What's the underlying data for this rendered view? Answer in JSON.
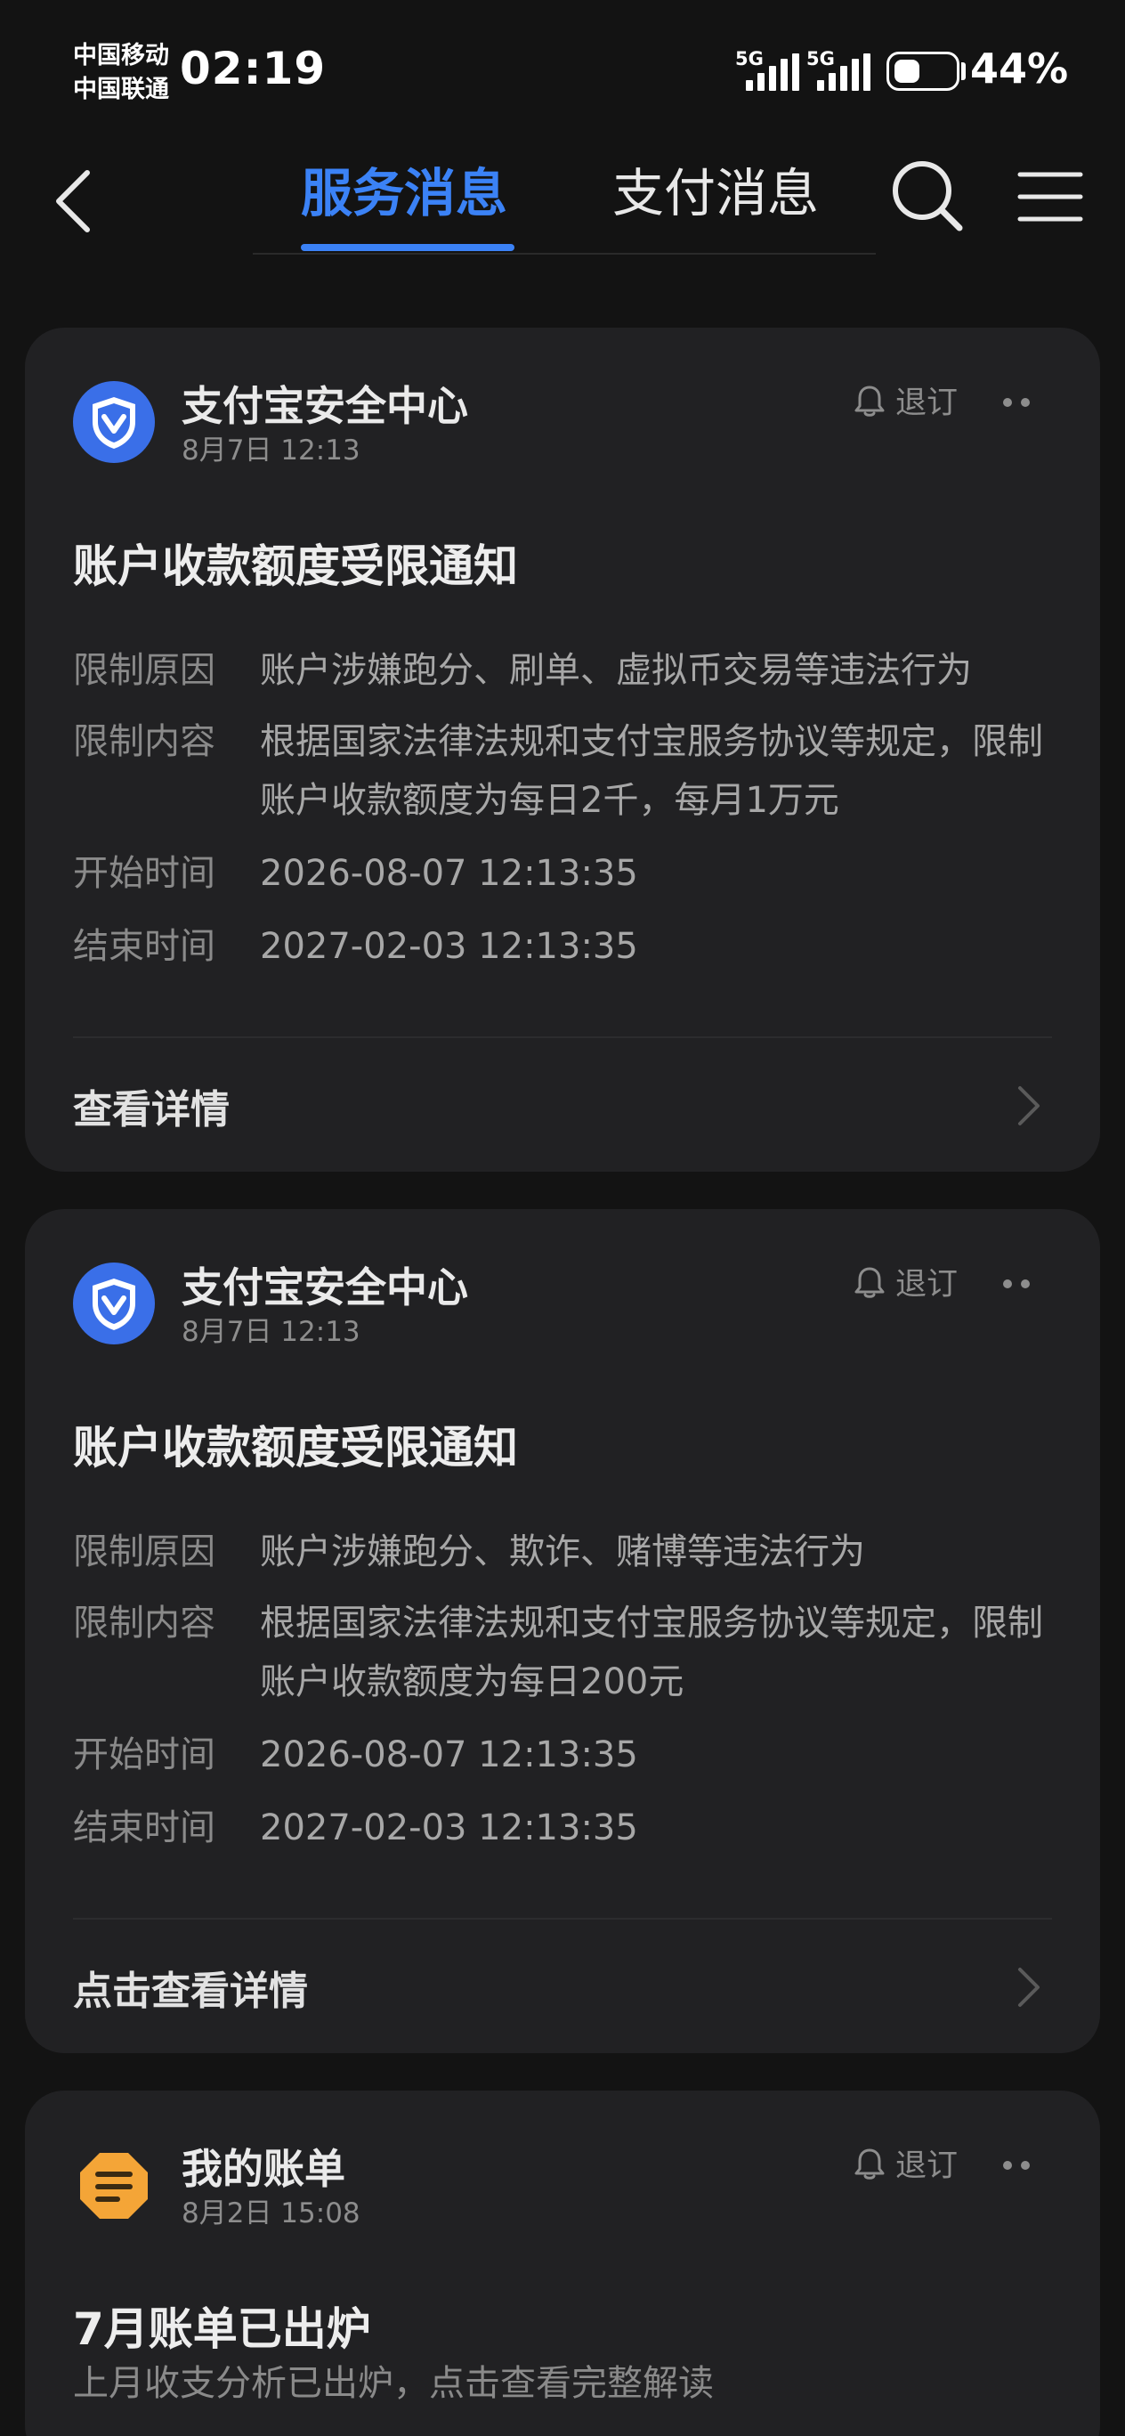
{
  "status_bar": {
    "carrier_1": "中国移动",
    "carrier_2": "中国联通",
    "time": "02:19",
    "signal_1": "5G",
    "signal_2": "5G",
    "battery_level": 0.44,
    "battery_percent": "44%"
  },
  "header": {
    "back_icon": "back-arrow-icon",
    "tabs": [
      {
        "label": "服务消息",
        "active": true
      },
      {
        "label": "支付消息",
        "active": false
      }
    ],
    "search_icon": "search-icon",
    "menu_icon": "menu-icon"
  },
  "colors": {
    "accent": "#3b82f6",
    "background": "#131313",
    "card": "#212123",
    "bill_icon": "#f4a537"
  },
  "messages": [
    {
      "sender": "支付宝安全中心",
      "time": "8月7日 12:13",
      "unsubscribe": "退订",
      "title": "账户收款额度受限通知",
      "fields": [
        {
          "key": "限制原因",
          "value": "账户涉嫌跑分、刷单、虚拟币交易等违法行为"
        },
        {
          "key": "限制内容",
          "value": "根据国家法律法规和支付宝服务协议等规定，限制账户收款额度为每日2千，每月1万元"
        },
        {
          "key": "开始时间",
          "value": "2026-08-07 12:13:35"
        },
        {
          "key": "结束时间",
          "value": "2027-02-03 12:13:35"
        }
      ],
      "action": "查看详情"
    },
    {
      "sender": "支付宝安全中心",
      "time": "8月7日 12:13",
      "unsubscribe": "退订",
      "title": "账户收款额度受限通知",
      "fields": [
        {
          "key": "限制原因",
          "value": "账户涉嫌跑分、欺诈、赌博等违法行为"
        },
        {
          "key": "限制内容",
          "value": "根据国家法律法规和支付宝服务协议等规定，限制账户收款额度为每日200元"
        },
        {
          "key": "开始时间",
          "value": "2026-08-07 12:13:35"
        },
        {
          "key": "结束时间",
          "value": "2027-02-03 12:13:35"
        }
      ],
      "action": "点击查看详情"
    },
    {
      "sender": "我的账单",
      "time": "8月2日 15:08",
      "unsubscribe": "退订",
      "title": "7月账单已出炉",
      "subtitle": "上月收支分析已出炉，点击查看完整解读"
    }
  ]
}
